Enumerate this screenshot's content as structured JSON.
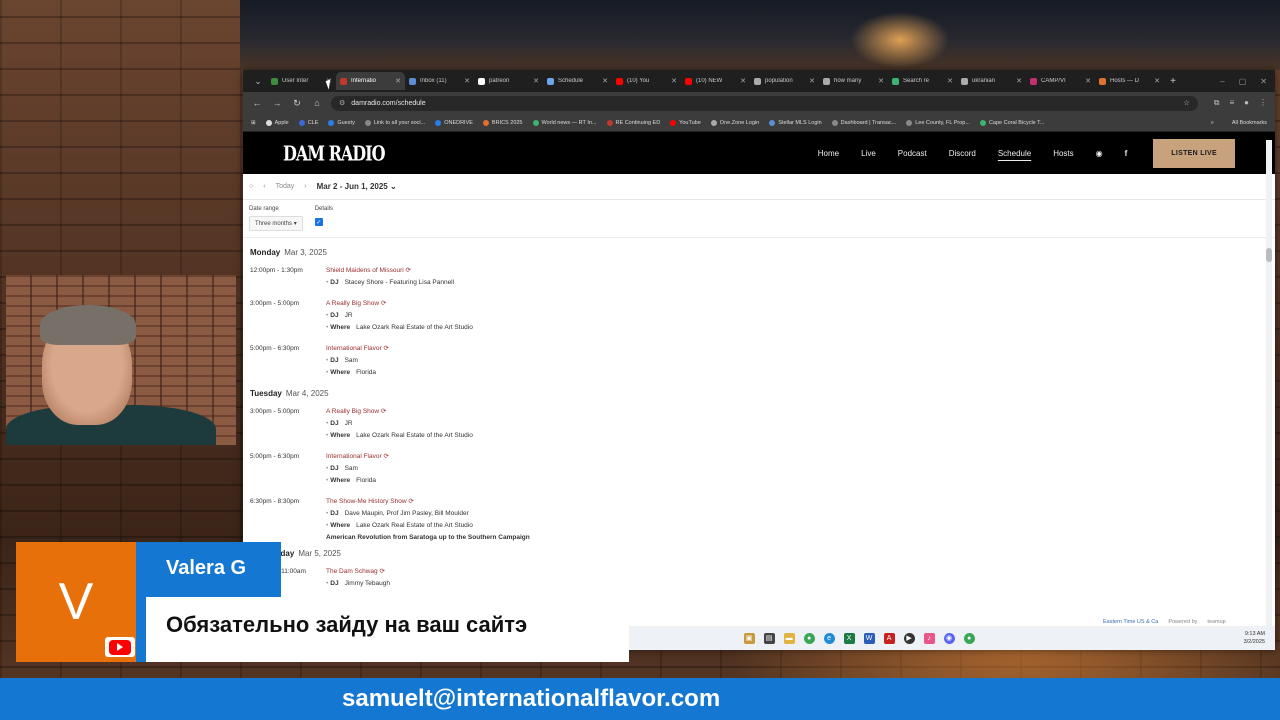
{
  "browser": {
    "tabs": [
      {
        "title": "User Inter",
        "color": "#3b8e3b",
        "active": false
      },
      {
        "title": "Internatio",
        "color": "#c0392b",
        "active": true
      },
      {
        "title": "Inbox (11)",
        "color": "#5a8fd6",
        "active": false
      },
      {
        "title": "patreon",
        "color": "#ffffff",
        "active": false
      },
      {
        "title": "Schedule",
        "color": "#6aa6e8",
        "active": false
      },
      {
        "title": "(10) You",
        "color": "#ff0000",
        "active": false
      },
      {
        "title": "(10) NEW",
        "color": "#ff0000",
        "active": false
      },
      {
        "title": "population",
        "color": "#aaaaaa",
        "active": false
      },
      {
        "title": "how many",
        "color": "#aaaaaa",
        "active": false
      },
      {
        "title": "Search re",
        "color": "#3cb371",
        "active": false
      },
      {
        "title": "ukranian",
        "color": "#aaaaaa",
        "active": false
      },
      {
        "title": "CAMP/VI",
        "color": "#c03070",
        "active": false
      },
      {
        "title": "Hosts — D",
        "color": "#e07030",
        "active": false
      }
    ],
    "url": "damradio.com/schedule",
    "bookmarks": [
      {
        "label": "Apple",
        "color": "#dddddd"
      },
      {
        "label": "CLE",
        "color": "#3a6ad6"
      },
      {
        "label": "Guesty",
        "color": "#2b7de9"
      },
      {
        "label": "Link to all your soci...",
        "color": "#888888"
      },
      {
        "label": "ONEDRIVE",
        "color": "#2b7de9"
      },
      {
        "label": "BRICS 2025",
        "color": "#e07030"
      },
      {
        "label": "World news — RT In...",
        "color": "#3cb371"
      },
      {
        "label": "RE Continuing ED",
        "color": "#c0392b"
      },
      {
        "label": "YouTube",
        "color": "#ff0000"
      },
      {
        "label": "One.Zone Login",
        "color": "#aaaaaa"
      },
      {
        "label": "Stellar MLS Login",
        "color": "#5a8fd6"
      },
      {
        "label": "Dashboard | Transac...",
        "color": "#888888"
      },
      {
        "label": "Lee County, FL Prop...",
        "color": "#888888"
      },
      {
        "label": "Cape Coral Bicycle T...",
        "color": "#3cb371"
      }
    ],
    "all_bookmarks": "All Bookmarks"
  },
  "site": {
    "logo": "DAM RADIO",
    "nav": [
      "Home",
      "Live",
      "Podcast",
      "Discord",
      "Schedule",
      "Hosts"
    ],
    "current": "Schedule",
    "listen_live": "LISTEN LIVE"
  },
  "calendar": {
    "today": "Today",
    "range": "Mar 2 - Jun 1, 2025",
    "date_range_label": "Date range",
    "date_range_value": "Three months",
    "details_label": "Details",
    "footer_tz": "Eastern Time US & Ca",
    "footer_powered": "Powered by",
    "footer_brand": "teamup",
    "days": [
      {
        "weekday": "Monday",
        "date": "Mar 3, 2025",
        "events": [
          {
            "time": "12:00pm - 1:30pm",
            "title": "Shield Maidens of Missouri",
            "dj": "Stacey Shore - Featuring Lisa Pannell",
            "where": ""
          },
          {
            "time": "3:00pm - 5:00pm",
            "title": "A Really Big Show",
            "dj": "JR",
            "where": "Lake Ozark Real Estate of the Art Studio"
          },
          {
            "time": "5:00pm - 6:30pm",
            "title": "International Flavor",
            "dj": "Sam",
            "where": "Florida"
          }
        ]
      },
      {
        "weekday": "Tuesday",
        "date": "Mar 4, 2025",
        "events": [
          {
            "time": "3:00pm - 5:00pm",
            "title": "A Really Big Show",
            "dj": "JR",
            "where": "Lake Ozark Real Estate of the Art Studio"
          },
          {
            "time": "5:00pm - 6:30pm",
            "title": "International Flavor",
            "dj": "Sam",
            "where": "Florida"
          },
          {
            "time": "6:30pm - 8:30pm",
            "title": "The Show-Me History Show",
            "dj": "Dave Maupin, Prof Jim Pasley, Bill Moulder",
            "where": "Lake Ozark Real Estate of the Art Studio",
            "note": "American Revolution from Saratoga up to the Southern Campaign"
          }
        ]
      },
      {
        "weekday": "Wednesday",
        "date": "Mar 5, 2025",
        "events": [
          {
            "time": "10:00am - 11:00am",
            "title": "The Dam Schwag",
            "dj": "Jimmy Tebaugh",
            "where": ""
          }
        ]
      }
    ],
    "dj_label": "DJ",
    "where_label": "Where"
  },
  "taskbar": {
    "time": "9:13 AM",
    "date": "3/2/2025"
  },
  "overlay": {
    "avatar_letter": "V",
    "name": "Valera G",
    "message": "Обязательно зайду на ваш сайтэ",
    "email": "samuelt@internationalflavor.com"
  }
}
